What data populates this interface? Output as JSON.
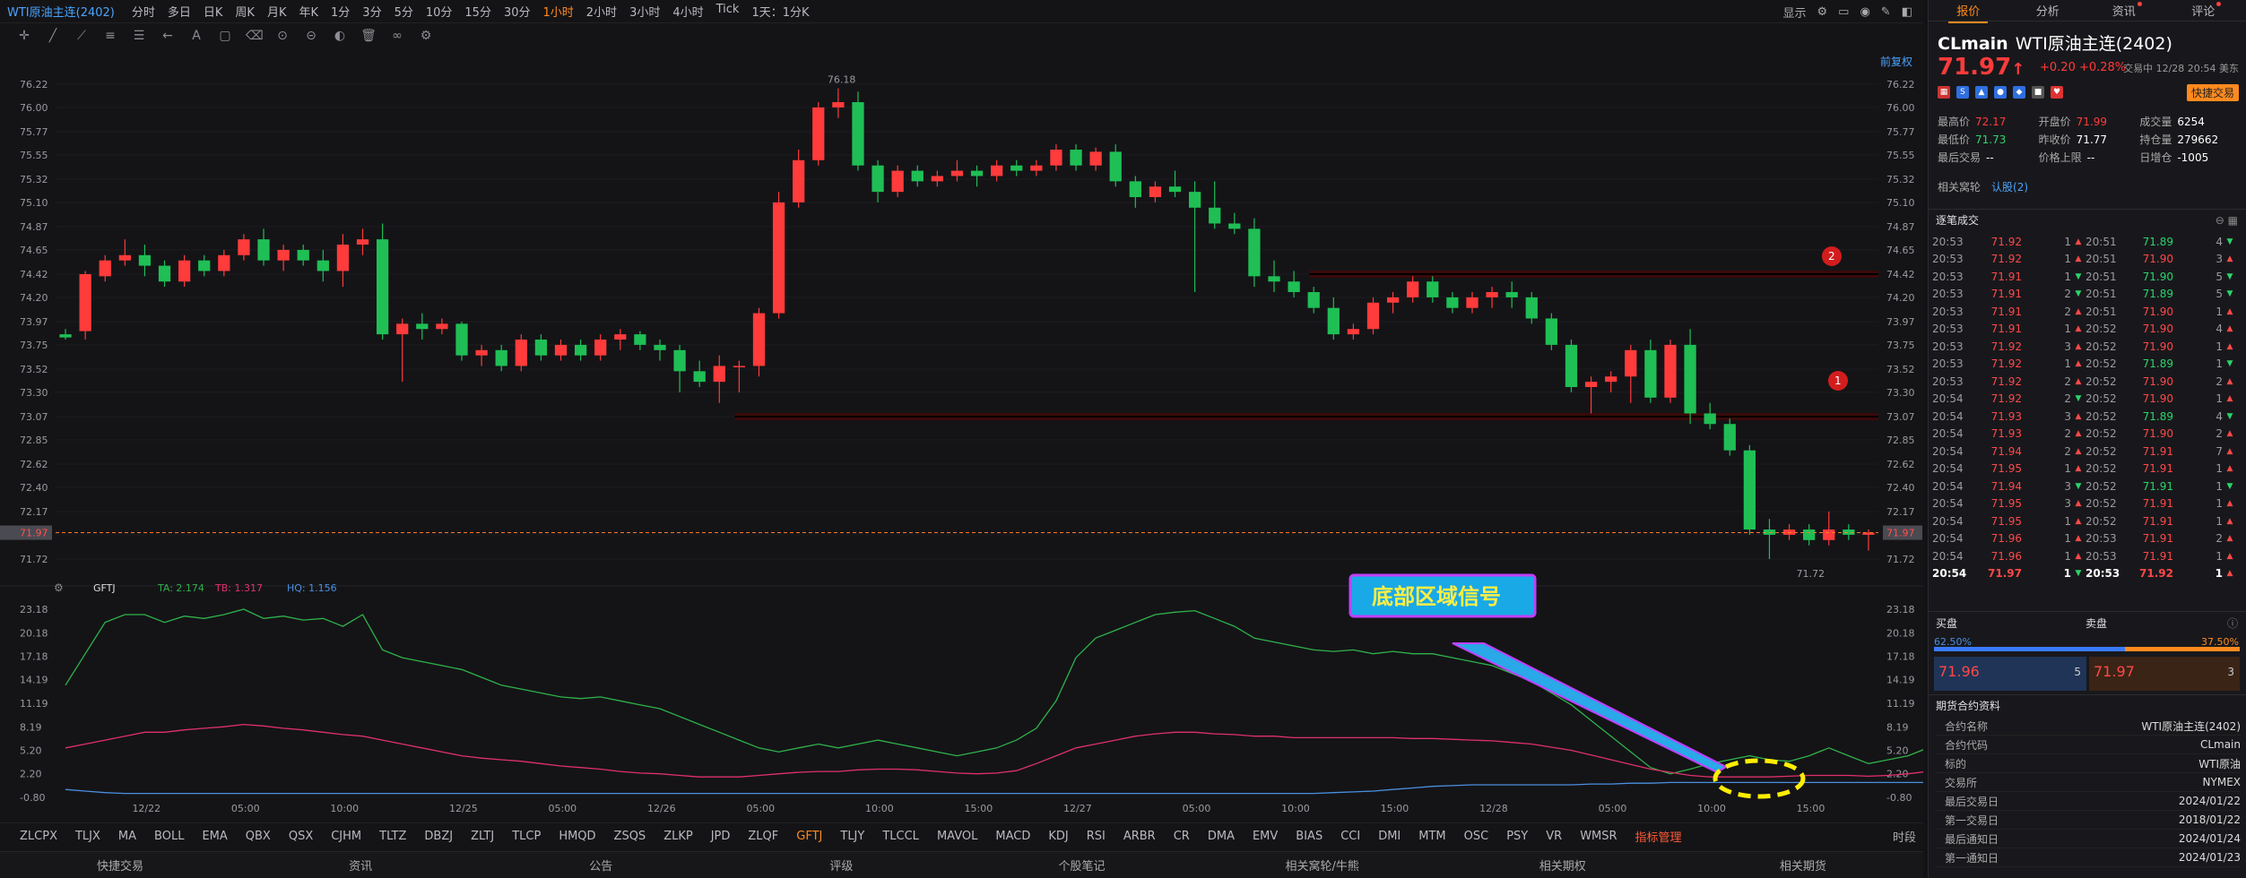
{
  "header": {
    "title": "WTI原油主连(2402)",
    "periods": [
      "分时",
      "多日",
      "日K",
      "周K",
      "月K",
      "年K",
      "1分",
      "3分",
      "5分",
      "10分",
      "15分",
      "30分",
      "1小时",
      "2小时",
      "3小时",
      "4小时",
      "Tick",
      "1天：1分K"
    ],
    "active_period": "1小时",
    "display_label": "显示",
    "qfq": "前复权"
  },
  "price_axis": [
    "76.22",
    "76.00",
    "75.77",
    "75.55",
    "75.32",
    "75.10",
    "74.87",
    "74.65",
    "74.42",
    "74.20",
    "73.97",
    "73.75",
    "73.52",
    "73.30",
    "73.07",
    "72.85",
    "72.62",
    "72.40",
    "72.17",
    "71.95",
    "71.72"
  ],
  "current_price_label": "71.97",
  "high_label": "76.18",
  "low_label": "71.72",
  "markers": {
    "m1": "1",
    "m2": "2"
  },
  "indicator": {
    "name": "GFTJ",
    "ta": "TA: 2.174",
    "tb": "TB: 1.317",
    "hq": "HQ: 1.156",
    "axis": [
      "23.18",
      "20.18",
      "17.18",
      "14.19",
      "11.19",
      "8.19",
      "5.20",
      "2.20",
      "-0.80"
    ],
    "callout": "底部区域信号",
    "colors": {
      "ta": "#2fb24a",
      "tb": "#e0306a",
      "hq": "#4a8fe0"
    }
  },
  "time_axis": [
    "12/22",
    "05:00",
    "10:00",
    "12/25",
    "05:00",
    "12/26",
    "05:00",
    "10:00",
    "15:00",
    "12/27",
    "05:00",
    "10:00",
    "15:00",
    "12/28",
    "05:00",
    "10:00",
    "15:00"
  ],
  "indicators_bar": [
    "ZLCPX",
    "TLJX",
    "MA",
    "BOLL",
    "EMA",
    "QBX",
    "QSX",
    "CJHM",
    "TLTZ",
    "DBZJ",
    "ZLTJ",
    "TLCP",
    "HMQD",
    "ZSQS",
    "ZLKP",
    "JPD",
    "ZLQF",
    "GFTJ",
    "TLJY",
    "TLCCL",
    "MAVOL",
    "MACD",
    "KDJ",
    "RSI",
    "ARBR",
    "CR",
    "DMA",
    "EMV",
    "BIAS",
    "CCI",
    "DMI",
    "MTM",
    "OSC",
    "PSY",
    "VR",
    "WMSR",
    "指标管理"
  ],
  "indicators_active": "GFTJ",
  "indicators_time": "时段",
  "bottom_bar": [
    "快捷交易",
    "资讯",
    "公告",
    "评级",
    "个股笔记",
    "相关窝轮/牛熊",
    "相关期权",
    "相关期货"
  ],
  "right": {
    "tabs": [
      "报价",
      "分析",
      "资讯",
      "评论"
    ],
    "symbol": "CLmain",
    "name": "WTI原油主连(2402)",
    "price": "71.97",
    "change": "+0.20 +0.28%",
    "trade_time": "交易中 12/28 20:54 美东",
    "quick_trade": "快捷交易",
    "stats": [
      {
        "label": "最高价",
        "value": "72.17",
        "cls": "up"
      },
      {
        "label": "开盘价",
        "value": "71.99",
        "cls": "up"
      },
      {
        "label": "成交量",
        "value": "6254",
        "cls": "wh"
      },
      {
        "label": "最低价",
        "value": "71.73",
        "cls": "dn"
      },
      {
        "label": "昨收价",
        "value": "71.77",
        "cls": "wh"
      },
      {
        "label": "持仓量",
        "value": "279662",
        "cls": "wh"
      },
      {
        "label": "最后交易",
        "value": "--",
        "cls": "wh"
      },
      {
        "label": "价格上限",
        "value": "--",
        "cls": "wh"
      },
      {
        "label": "日增仓",
        "value": "-1005",
        "cls": "wh"
      }
    ],
    "related": "相关窝轮",
    "related_b": "认股(2)",
    "trades_title": "逐笔成交",
    "trades": [
      [
        "20:53",
        "71.92",
        "1",
        "up",
        "20:51",
        "71.89",
        "4",
        "dn"
      ],
      [
        "20:53",
        "71.92",
        "1",
        "up",
        "20:51",
        "71.90",
        "3",
        "up"
      ],
      [
        "20:53",
        "71.91",
        "1",
        "dn",
        "20:51",
        "71.90",
        "5",
        "dn"
      ],
      [
        "20:53",
        "71.91",
        "2",
        "dn",
        "20:51",
        "71.89",
        "5",
        "dn"
      ],
      [
        "20:53",
        "71.91",
        "2",
        "up",
        "20:51",
        "71.90",
        "1",
        "up"
      ],
      [
        "20:53",
        "71.91",
        "1",
        "up",
        "20:52",
        "71.90",
        "4",
        "up"
      ],
      [
        "20:53",
        "71.92",
        "3",
        "up",
        "20:52",
        "71.90",
        "1",
        "up"
      ],
      [
        "20:53",
        "71.92",
        "1",
        "up",
        "20:52",
        "71.89",
        "1",
        "dn"
      ],
      [
        "20:53",
        "71.92",
        "2",
        "up",
        "20:52",
        "71.90",
        "2",
        "up"
      ],
      [
        "20:54",
        "71.92",
        "2",
        "dn",
        "20:52",
        "71.90",
        "1",
        "up"
      ],
      [
        "20:54",
        "71.93",
        "3",
        "up",
        "20:52",
        "71.89",
        "4",
        "dn"
      ],
      [
        "20:54",
        "71.93",
        "2",
        "up",
        "20:52",
        "71.90",
        "2",
        "up"
      ],
      [
        "20:54",
        "71.94",
        "2",
        "up",
        "20:52",
        "71.91",
        "7",
        "up"
      ],
      [
        "20:54",
        "71.95",
        "1",
        "up",
        "20:52",
        "71.91",
        "1",
        "up"
      ],
      [
        "20:54",
        "71.94",
        "3",
        "dn",
        "20:52",
        "71.91",
        "1",
        "dn"
      ],
      [
        "20:54",
        "71.95",
        "3",
        "up",
        "20:52",
        "71.91",
        "1",
        "up"
      ],
      [
        "20:54",
        "71.95",
        "1",
        "up",
        "20:52",
        "71.91",
        "1",
        "up"
      ],
      [
        "20:54",
        "71.96",
        "1",
        "up",
        "20:53",
        "71.91",
        "2",
        "up"
      ],
      [
        "20:54",
        "71.96",
        "1",
        "up",
        "20:53",
        "71.91",
        "1",
        "up"
      ],
      [
        "20:54",
        "71.97",
        "1",
        "dn",
        "20:53",
        "71.92",
        "1",
        "up"
      ]
    ],
    "bid_label": "买盘",
    "ask_label": "卖盘",
    "bid_pct": "62.50%",
    "ask_pct": "37.50%",
    "bid_pct_value": 62.5,
    "bid_price": "71.96",
    "bid_size": "5",
    "ask_price": "71.97",
    "ask_size": "3",
    "info_title": "期货合约资料",
    "info": [
      [
        "合约名称",
        "WTI原油主连(2402)"
      ],
      [
        "合约代码",
        "CLmain"
      ],
      [
        "标的",
        "WTI原油"
      ],
      [
        "交易所",
        "NYMEX"
      ],
      [
        "最后交易日",
        "2024/01/22"
      ],
      [
        "第一交易日",
        "2018/01/22"
      ],
      [
        "最后通知日",
        "2024/01/24"
      ],
      [
        "第一通知日",
        "2024/01/23"
      ]
    ]
  },
  "chart_data": {
    "type": "candlestick",
    "ohlc": [
      [
        73.85,
        73.9,
        73.8,
        73.82
      ],
      [
        73.88,
        74.45,
        73.8,
        74.42
      ],
      [
        74.4,
        74.6,
        74.35,
        74.55
      ],
      [
        74.55,
        74.75,
        74.5,
        74.6
      ],
      [
        74.6,
        74.7,
        74.4,
        74.5
      ],
      [
        74.5,
        74.55,
        74.3,
        74.35
      ],
      [
        74.35,
        74.6,
        74.3,
        74.55
      ],
      [
        74.55,
        74.6,
        74.4,
        74.45
      ],
      [
        74.45,
        74.65,
        74.4,
        74.6
      ],
      [
        74.6,
        74.8,
        74.55,
        74.75
      ],
      [
        74.75,
        74.85,
        74.5,
        74.55
      ],
      [
        74.55,
        74.7,
        74.45,
        74.65
      ],
      [
        74.65,
        74.7,
        74.5,
        74.55
      ],
      [
        74.55,
        74.65,
        74.35,
        74.45
      ],
      [
        74.45,
        74.8,
        74.3,
        74.7
      ],
      [
        74.7,
        74.85,
        74.6,
        74.75
      ],
      [
        74.75,
        74.9,
        73.8,
        73.85
      ],
      [
        73.85,
        74.0,
        73.4,
        73.95
      ],
      [
        73.95,
        74.05,
        73.8,
        73.9
      ],
      [
        73.9,
        74.0,
        73.85,
        73.95
      ],
      [
        73.95,
        73.97,
        73.6,
        73.65
      ],
      [
        73.65,
        73.75,
        73.55,
        73.7
      ],
      [
        73.7,
        73.75,
        73.5,
        73.55
      ],
      [
        73.55,
        73.85,
        73.5,
        73.8
      ],
      [
        73.8,
        73.85,
        73.6,
        73.65
      ],
      [
        73.65,
        73.8,
        73.6,
        73.75
      ],
      [
        73.75,
        73.8,
        73.6,
        73.65
      ],
      [
        73.65,
        73.85,
        73.6,
        73.8
      ],
      [
        73.8,
        73.9,
        73.7,
        73.85
      ],
      [
        73.85,
        73.88,
        73.7,
        73.75
      ],
      [
        73.75,
        73.8,
        73.6,
        73.7
      ],
      [
        73.7,
        73.75,
        73.3,
        73.5
      ],
      [
        73.5,
        73.6,
        73.35,
        73.4
      ],
      [
        73.4,
        73.65,
        73.2,
        73.55
      ],
      [
        73.55,
        73.6,
        73.3,
        73.55
      ],
      [
        73.55,
        74.1,
        73.45,
        74.05
      ],
      [
        74.05,
        75.2,
        74.0,
        75.1
      ],
      [
        75.1,
        75.6,
        75.05,
        75.5
      ],
      [
        75.5,
        76.05,
        75.45,
        76.0
      ],
      [
        76.0,
        76.18,
        75.9,
        76.05
      ],
      [
        76.05,
        76.15,
        75.4,
        75.45
      ],
      [
        75.45,
        75.5,
        75.1,
        75.2
      ],
      [
        75.2,
        75.45,
        75.15,
        75.4
      ],
      [
        75.4,
        75.45,
        75.25,
        75.3
      ],
      [
        75.3,
        75.4,
        75.25,
        75.35
      ],
      [
        75.35,
        75.5,
        75.3,
        75.4
      ],
      [
        75.4,
        75.45,
        75.25,
        75.35
      ],
      [
        75.35,
        75.5,
        75.3,
        75.45
      ],
      [
        75.45,
        75.5,
        75.35,
        75.4
      ],
      [
        75.4,
        75.5,
        75.35,
        75.45
      ],
      [
        75.45,
        75.65,
        75.4,
        75.6
      ],
      [
        75.6,
        75.65,
        75.4,
        75.45
      ],
      [
        75.45,
        75.62,
        75.4,
        75.58
      ],
      [
        75.58,
        75.65,
        75.25,
        75.3
      ],
      [
        75.3,
        75.35,
        75.05,
        75.15
      ],
      [
        75.15,
        75.3,
        75.1,
        75.25
      ],
      [
        75.25,
        75.4,
        75.15,
        75.2
      ],
      [
        75.2,
        75.3,
        74.25,
        75.05
      ],
      [
        75.05,
        75.3,
        74.85,
        74.9
      ],
      [
        74.9,
        75.0,
        74.8,
        74.85
      ],
      [
        74.85,
        74.95,
        74.3,
        74.4
      ],
      [
        74.4,
        74.55,
        74.25,
        74.35
      ],
      [
        74.35,
        74.45,
        74.2,
        74.25
      ],
      [
        74.25,
        74.3,
        74.05,
        74.1
      ],
      [
        74.1,
        74.2,
        73.8,
        73.85
      ],
      [
        73.85,
        73.95,
        73.8,
        73.9
      ],
      [
        73.9,
        74.2,
        73.85,
        74.15
      ],
      [
        74.15,
        74.25,
        74.05,
        74.2
      ],
      [
        74.2,
        74.4,
        74.15,
        74.35
      ],
      [
        74.35,
        74.4,
        74.15,
        74.2
      ],
      [
        74.2,
        74.25,
        74.05,
        74.1
      ],
      [
        74.1,
        74.25,
        74.05,
        74.2
      ],
      [
        74.2,
        74.3,
        74.1,
        74.25
      ],
      [
        74.25,
        74.35,
        74.1,
        74.2
      ],
      [
        74.2,
        74.25,
        73.95,
        74.0
      ],
      [
        74.0,
        74.05,
        73.7,
        73.75
      ],
      [
        73.75,
        73.8,
        73.3,
        73.35
      ],
      [
        73.35,
        73.45,
        73.1,
        73.4
      ],
      [
        73.4,
        73.5,
        73.3,
        73.45
      ],
      [
        73.45,
        73.75,
        73.2,
        73.7
      ],
      [
        73.7,
        73.8,
        73.2,
        73.25
      ],
      [
        73.25,
        73.8,
        73.2,
        73.75
      ],
      [
        73.75,
        73.9,
        73.0,
        73.1
      ],
      [
        73.1,
        73.2,
        72.95,
        73.0
      ],
      [
        73.0,
        73.05,
        72.7,
        72.75
      ],
      [
        72.75,
        72.8,
        71.95,
        72.0
      ],
      [
        72.0,
        72.1,
        71.72,
        71.95
      ],
      [
        71.95,
        72.05,
        71.9,
        72.0
      ],
      [
        72.0,
        72.05,
        71.85,
        71.9
      ],
      [
        71.9,
        72.17,
        71.85,
        72.0
      ],
      [
        72.0,
        72.05,
        71.9,
        71.95
      ],
      [
        71.95,
        72.0,
        71.8,
        71.97
      ]
    ],
    "resistance_lines": [
      74.42,
      73.07
    ],
    "indicator_ta": [
      13.5,
      17.5,
      21.5,
      22.5,
      22.5,
      21.5,
      22.3,
      22.0,
      22.5,
      23.18,
      22.0,
      22.3,
      21.8,
      22.0,
      21.0,
      22.5,
      18.0,
      17.0,
      16.5,
      16.0,
      15.5,
      14.5,
      13.5,
      13.0,
      12.5,
      12.0,
      11.8,
      12.0,
      11.5,
      11.0,
      10.5,
      9.5,
      8.5,
      7.5,
      6.5,
      5.5,
      5.0,
      5.5,
      6.0,
      5.5,
      6.0,
      6.5,
      6.0,
      5.5,
      5.0,
      4.5,
      5.0,
      5.5,
      6.5,
      8.0,
      11.5,
      17.0,
      19.5,
      20.5,
      21.5,
      22.5,
      22.8,
      23.0,
      22.0,
      21.0,
      19.5,
      19.0,
      18.5,
      18.0,
      17.8,
      18.0,
      17.5,
      17.8,
      17.5,
      17.5,
      17.0,
      16.5,
      16.0,
      15.0,
      14.0,
      12.5,
      11.0,
      9.0,
      7.0,
      5.0,
      3.0,
      2.2,
      2.8,
      3.5,
      4.0,
      4.5,
      4.0,
      3.8,
      4.5,
      5.5,
      4.5,
      3.5,
      4.0,
      4.5,
      5.5,
      6.5,
      7.5,
      7.0,
      5.5,
      3.0,
      2.0,
      2.3,
      2.4,
      2.2,
      2.174
    ],
    "indicator_tb": [
      5.5,
      6.0,
      6.5,
      7.0,
      7.5,
      7.5,
      7.8,
      8.0,
      8.2,
      8.5,
      8.3,
      8.0,
      7.8,
      7.5,
      7.2,
      7.0,
      6.5,
      6.0,
      5.5,
      5.0,
      4.5,
      4.2,
      4.0,
      3.8,
      3.5,
      3.2,
      3.0,
      2.8,
      2.5,
      2.3,
      2.2,
      2.0,
      1.8,
      1.8,
      1.8,
      2.0,
      2.2,
      2.4,
      2.5,
      2.5,
      2.7,
      2.8,
      2.8,
      2.7,
      2.5,
      2.3,
      2.2,
      2.3,
      2.6,
      3.5,
      4.5,
      5.5,
      6.0,
      6.5,
      7.0,
      7.3,
      7.5,
      7.5,
      7.3,
      7.2,
      7.0,
      7.0,
      6.8,
      6.8,
      6.8,
      6.8,
      6.8,
      6.8,
      6.7,
      6.7,
      6.6,
      6.5,
      6.4,
      6.2,
      6.0,
      5.6,
      5.2,
      4.6,
      4.0,
      3.4,
      2.8,
      2.4,
      2.0,
      1.8,
      1.8,
      1.8,
      1.8,
      1.9,
      2.0,
      2.0,
      2.0,
      1.9,
      2.0,
      2.2,
      2.5,
      2.8,
      3.0,
      3.2,
      3.0,
      2.6,
      2.0,
      1.6,
      1.4,
      1.35,
      1.317
    ],
    "indicator_hq": [
      0.2,
      0.0,
      -0.2,
      -0.3,
      -0.3,
      -0.3,
      -0.3,
      -0.3,
      -0.3,
      -0.3,
      -0.3,
      -0.3,
      -0.3,
      -0.3,
      -0.3,
      -0.3,
      -0.3,
      -0.3,
      -0.3,
      -0.3,
      -0.3,
      -0.3,
      -0.3,
      -0.3,
      -0.3,
      -0.3,
      -0.3,
      -0.3,
      -0.3,
      -0.3,
      -0.3,
      -0.3,
      -0.3,
      -0.3,
      -0.3,
      -0.3,
      -0.3,
      -0.3,
      -0.3,
      -0.3,
      -0.3,
      -0.3,
      -0.3,
      -0.3,
      -0.3,
      -0.3,
      -0.3,
      -0.3,
      -0.3,
      -0.3,
      -0.3,
      -0.3,
      -0.3,
      -0.3,
      -0.3,
      -0.3,
      -0.3,
      -0.3,
      -0.3,
      -0.3,
      -0.3,
      -0.3,
      -0.3,
      -0.3,
      -0.2,
      -0.1,
      0.0,
      0.2,
      0.4,
      0.6,
      0.7,
      0.8,
      0.8,
      0.8,
      0.8,
      0.8,
      0.8,
      0.9,
      0.9,
      1.0,
      1.0,
      1.1,
      1.1,
      1.1,
      1.1,
      1.1,
      1.1,
      1.1,
      1.1,
      1.1,
      1.1,
      1.1,
      1.1,
      1.1,
      1.1,
      1.1,
      1.1,
      1.1,
      1.1,
      1.1,
      1.1,
      1.1,
      1.156,
      1.156,
      1.156
    ],
    "price_ylim": [
      71.72,
      76.22
    ],
    "indicator_ylim": [
      -0.8,
      23.18
    ]
  }
}
